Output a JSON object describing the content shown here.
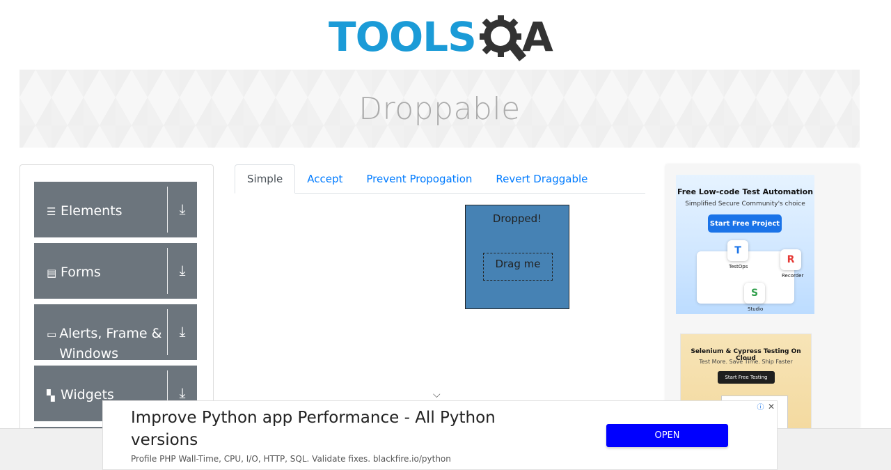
{
  "header": {
    "logo_text_left": "TOOLS",
    "logo_text_right": "A"
  },
  "banner": {
    "title": "Droppable"
  },
  "sidebar": {
    "groups": [
      {
        "label": "Elements",
        "icon": "menu-icon"
      },
      {
        "label": "Forms",
        "icon": "form-icon"
      },
      {
        "label": "Alerts, Frame & Windows",
        "icon": "window-icon"
      },
      {
        "label": "Widgets",
        "icon": "widgets-icon"
      }
    ]
  },
  "tabs": [
    {
      "label": "Simple",
      "active": true
    },
    {
      "label": "Accept",
      "active": false
    },
    {
      "label": "Prevent Propogation",
      "active": false
    },
    {
      "label": "Revert Draggable",
      "active": false
    }
  ],
  "simple": {
    "drop_text": "Dropped!",
    "drag_text": "Drag me"
  },
  "colors": {
    "drop_bg": "#4682b4",
    "sidebar_group": "#6c757d",
    "link": "#007bff",
    "brand_blue": "#1b9bd7"
  },
  "ads": {
    "ad1": {
      "title": "Free Low-code Test Automation",
      "subtitle": "Simplified Secure Community's choice",
      "button": "Start Free Project",
      "chips": [
        {
          "letter": "T",
          "label": "TestOps"
        },
        {
          "letter": "R",
          "label": "Recorder"
        },
        {
          "letter": "S",
          "label": "Studio"
        }
      ]
    },
    "ad2": {
      "title": "Selenium & Cypress Testing On Cloud",
      "subtitle": "Test More. Save Time. Ship Faster",
      "button": "Start Free Testing"
    },
    "bottom": {
      "headline": "Improve Python app Performance - All Python versions",
      "description": "Profile PHP Wall-Time, CPU, I/O, HTTP, SQL. Validate fixes. blackfire.io/python",
      "button": "OPEN"
    }
  }
}
